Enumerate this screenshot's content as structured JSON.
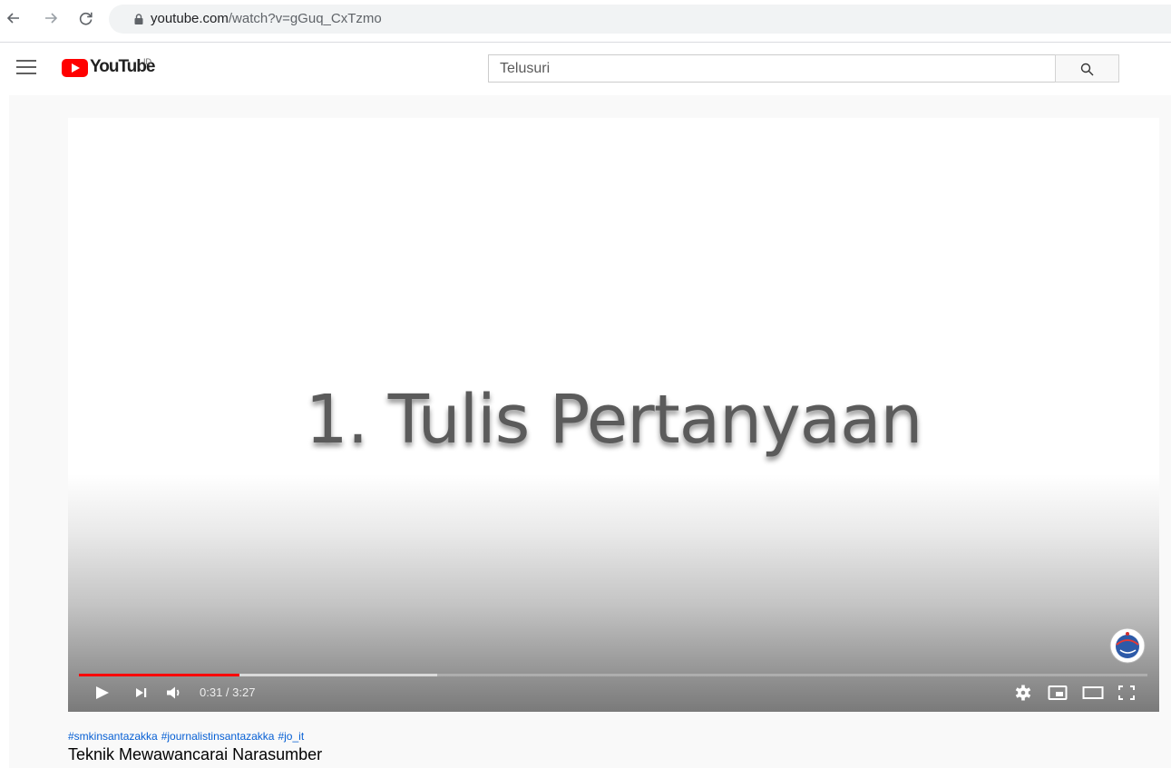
{
  "browser": {
    "url_domain": "youtube.com",
    "url_path": "/watch?v=gGuq_CxTzmo",
    "back_icon": "arrow-left-icon",
    "forward_icon": "arrow-right-icon",
    "reload_icon": "reload-icon"
  },
  "header": {
    "logo_text": "YouTube",
    "country_code": "ID",
    "search_placeholder": "Telusuri",
    "search_value": ""
  },
  "player": {
    "slide_text": "1. Tulis Pertanyaan",
    "current_time": "0:31",
    "duration": "3:27",
    "played_fraction": 0.15,
    "buffered_fraction": 0.335,
    "colors": {
      "progress_played": "#ff0000"
    }
  },
  "video": {
    "hashtags": [
      "#smkinsantazakka",
      "#journalistinsantazakka",
      "#jo_it"
    ],
    "title": "Teknik Mewawancarai Narasumber"
  }
}
